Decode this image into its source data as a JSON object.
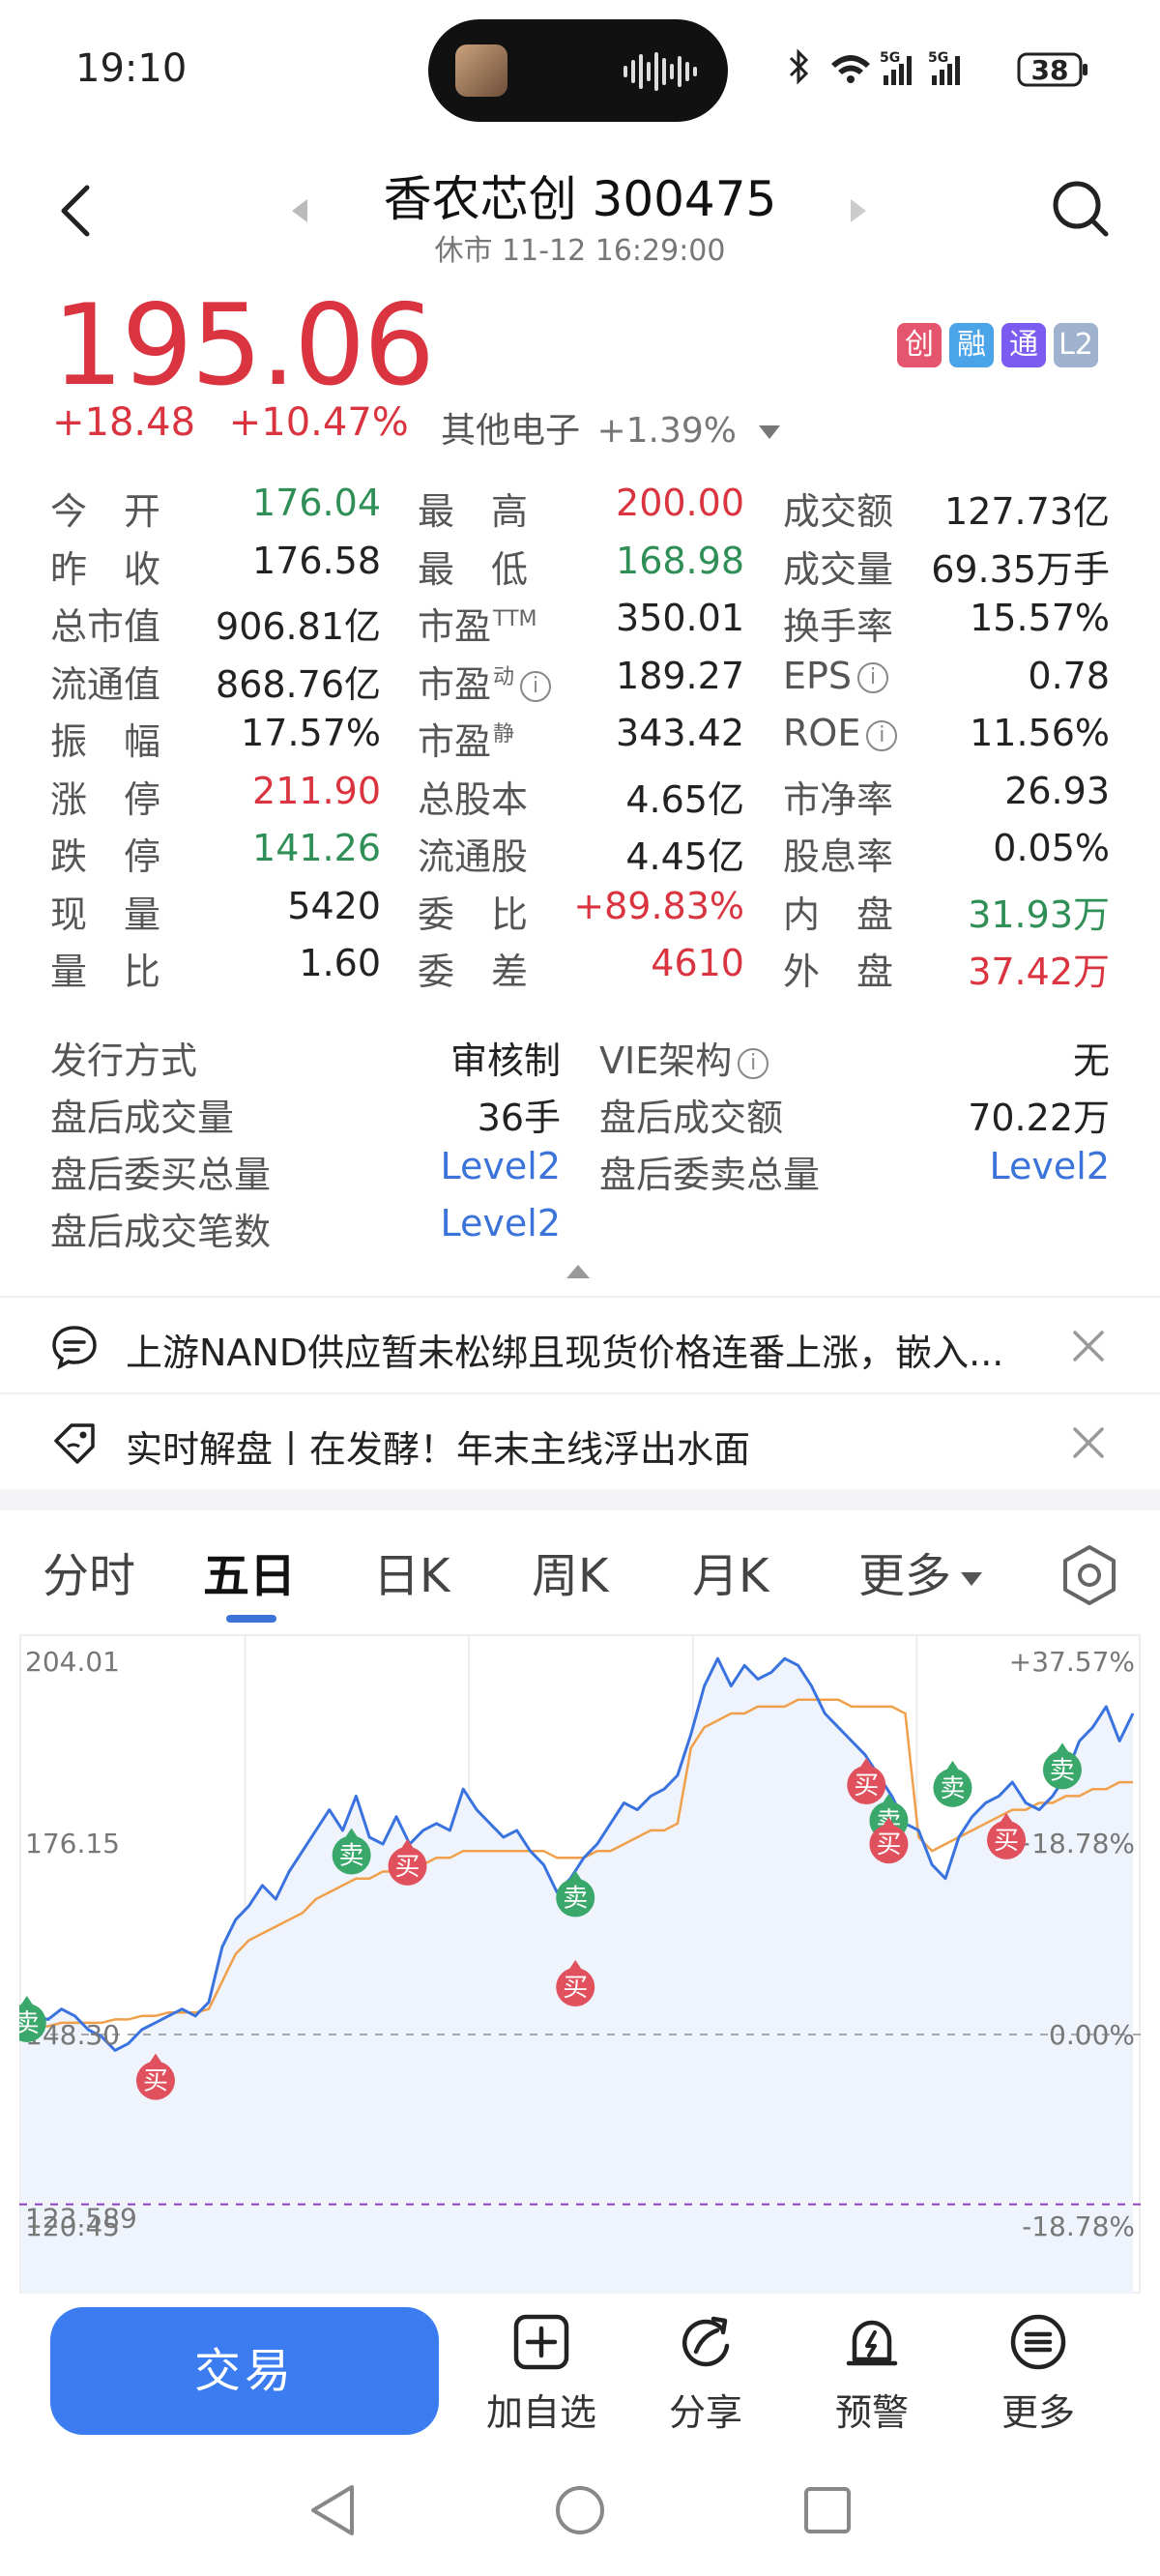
{
  "status_bar": {
    "time": "19:10",
    "battery": "38"
  },
  "header": {
    "title": "香农芯创 300475",
    "subtitle": "休市 11-12 16:29:00"
  },
  "price": {
    "last": "195.06",
    "change": "+18.48",
    "change_pct": "+10.47%",
    "sector_name": "其他电子",
    "sector_pct": "+1.39%"
  },
  "badges": [
    {
      "text": "创",
      "color": "#e5566e"
    },
    {
      "text": "融",
      "color": "#4ba3e8"
    },
    {
      "text": "通",
      "color": "#7b5cf0"
    },
    {
      "text": "L2",
      "color": "#9fb3cf"
    }
  ],
  "quote_rows": [
    [
      {
        "label": "今　开",
        "value": "176.04",
        "color": "green"
      },
      {
        "label": "最　高",
        "value": "200.00",
        "color": "red"
      },
      {
        "label": "成交额",
        "value": "127.73亿",
        "color": ""
      }
    ],
    [
      {
        "label": "昨　收",
        "value": "176.58",
        "color": ""
      },
      {
        "label": "最　低",
        "value": "168.98",
        "color": "green"
      },
      {
        "label": "成交量",
        "value": "69.35万手",
        "color": ""
      }
    ],
    [
      {
        "label": "总市值",
        "value": "906.81亿",
        "color": ""
      },
      {
        "label": "市盈",
        "sup": "TTM",
        "value": "350.01",
        "color": ""
      },
      {
        "label": "换手率",
        "value": "15.57%",
        "color": ""
      }
    ],
    [
      {
        "label": "流通值",
        "value": "868.76亿",
        "color": ""
      },
      {
        "label": "市盈",
        "sup": "动",
        "info": true,
        "value": "189.27",
        "color": ""
      },
      {
        "label": "EPS",
        "info": true,
        "value": "0.78",
        "color": ""
      }
    ],
    [
      {
        "label": "振　幅",
        "value": "17.57%",
        "color": ""
      },
      {
        "label": "市盈",
        "sup": "静",
        "value": "343.42",
        "color": ""
      },
      {
        "label": "ROE",
        "info": true,
        "value": "11.56%",
        "color": ""
      }
    ],
    [
      {
        "label": "涨　停",
        "value": "211.90",
        "color": "red"
      },
      {
        "label": "总股本",
        "value": "4.65亿",
        "color": ""
      },
      {
        "label": "市净率",
        "value": "26.93",
        "color": ""
      }
    ],
    [
      {
        "label": "跌　停",
        "value": "141.26",
        "color": "green"
      },
      {
        "label": "流通股",
        "value": "4.45亿",
        "color": ""
      },
      {
        "label": "股息率",
        "value": "0.05%",
        "color": ""
      }
    ],
    [
      {
        "label": "现　量",
        "value": "5420",
        "color": ""
      },
      {
        "label": "委　比",
        "value": "+89.83%",
        "color": "red"
      },
      {
        "label": "内　盘",
        "value": "31.93万",
        "color": "green"
      }
    ],
    [
      {
        "label": "量　比",
        "value": "1.60",
        "color": ""
      },
      {
        "label": "委　差",
        "value": "4610",
        "color": "red"
      },
      {
        "label": "外　盘",
        "value": "37.42万",
        "color": "red"
      }
    ]
  ],
  "after_hours": [
    [
      {
        "label": "发行方式",
        "value": "审核制",
        "color": ""
      },
      {
        "label": "VIE架构",
        "info": true,
        "value": "无",
        "color": ""
      }
    ],
    [
      {
        "label": "盘后成交量",
        "value": "36手",
        "color": ""
      },
      {
        "label": "盘后成交额",
        "value": "70.22万",
        "color": ""
      }
    ],
    [
      {
        "label": "盘后委买总量",
        "value": "Level2",
        "color": "blue"
      },
      {
        "label": "盘后委卖总量",
        "value": "Level2",
        "color": "blue"
      }
    ],
    [
      {
        "label": "盘后成交笔数",
        "value": "Level2",
        "color": "blue"
      }
    ]
  ],
  "news": [
    "上游NAND供应暂未松绑且现货价格连番上涨，嵌入...",
    "实时解盘丨在发酵！年末主线浮出水面"
  ],
  "tabs": [
    "分时",
    "五日",
    "日K",
    "周K",
    "月K",
    "更多"
  ],
  "active_tab": "五日",
  "chart_data": {
    "type": "line",
    "y_labels_left": [
      "204.01",
      "176.15",
      "148.30",
      "120.45"
    ],
    "y_labels_right": [
      "+37.57%",
      "+18.78%",
      "0.00%",
      "-18.78%"
    ],
    "ylim": [
      120.45,
      204.01
    ],
    "reference_line": {
      "label": "123.589",
      "value": 123.589,
      "color": "#8e3fbf"
    },
    "days": 5,
    "series": [
      {
        "values": [
          150,
          151,
          150.5,
          152,
          151,
          149,
          148,
          146,
          147,
          149,
          150,
          151,
          152,
          151,
          153,
          161,
          165,
          167,
          170,
          168,
          172,
          175,
          178,
          181,
          178,
          183,
          177,
          176,
          180,
          176,
          178,
          179,
          178,
          184,
          181,
          179,
          177,
          178,
          175,
          173,
          169,
          171,
          174,
          176,
          179,
          182,
          181,
          183,
          184,
          186,
          192,
          199,
          203,
          199,
          202,
          200,
          201,
          203,
          202,
          199,
          195,
          193,
          191,
          189,
          186,
          183,
          179,
          178,
          173,
          171,
          177,
          180,
          182,
          183,
          185,
          182,
          181,
          183,
          186,
          191,
          193,
          196,
          191,
          195
        ]
      },
      {
        "values": [
          149,
          149.5,
          149.5,
          150,
          150,
          150,
          150,
          150.5,
          150.5,
          151,
          151,
          151.5,
          151.5,
          151.5,
          152,
          156,
          160,
          162,
          163,
          164,
          165,
          166,
          168,
          169,
          170,
          171,
          171,
          172,
          172,
          173,
          173,
          174,
          174,
          175,
          175,
          175,
          175,
          175,
          175,
          175,
          174,
          174,
          174,
          175,
          175,
          176,
          177,
          178,
          178,
          179,
          190,
          193,
          194,
          195,
          195,
          196,
          196,
          196,
          197,
          197,
          197,
          197,
          196,
          196,
          196,
          196,
          195,
          177,
          175,
          176,
          177,
          178,
          179,
          180,
          181,
          181,
          182,
          182,
          183,
          183,
          184,
          184,
          185,
          185
        ]
      }
    ],
    "signals": [
      {
        "text": "卖",
        "type": "sell",
        "x": 0.005,
        "y": 150
      },
      {
        "text": "买",
        "type": "buy",
        "x": 0.12,
        "y": 141.6
      },
      {
        "text": "卖",
        "type": "sell",
        "x": 0.295,
        "y": 174.4
      },
      {
        "text": "买",
        "type": "buy",
        "x": 0.345,
        "y": 172.8
      },
      {
        "text": "卖",
        "type": "sell",
        "x": 0.495,
        "y": 168.2
      },
      {
        "text": "买",
        "type": "buy",
        "x": 0.495,
        "y": 155.2
      },
      {
        "text": "买",
        "type": "buy",
        "x": 0.755,
        "y": 184.6
      },
      {
        "text": "卖",
        "type": "sell",
        "x": 0.775,
        "y": 179.4
      },
      {
        "text": "买",
        "type": "buy",
        "x": 0.775,
        "y": 176.0
      },
      {
        "text": "卖",
        "type": "sell",
        "x": 0.832,
        "y": 184.2
      },
      {
        "text": "买",
        "type": "buy",
        "x": 0.88,
        "y": 176.6
      },
      {
        "text": "卖",
        "type": "sell",
        "x": 0.93,
        "y": 186.8
      }
    ]
  },
  "bottom_bar": {
    "trade": "交易",
    "items": [
      {
        "label": "加自选",
        "icon": "add-watchlist-icon"
      },
      {
        "label": "分享",
        "icon": "share-icon"
      },
      {
        "label": "预警",
        "icon": "alert-icon"
      },
      {
        "label": "更多",
        "icon": "more-menu-icon"
      }
    ]
  }
}
